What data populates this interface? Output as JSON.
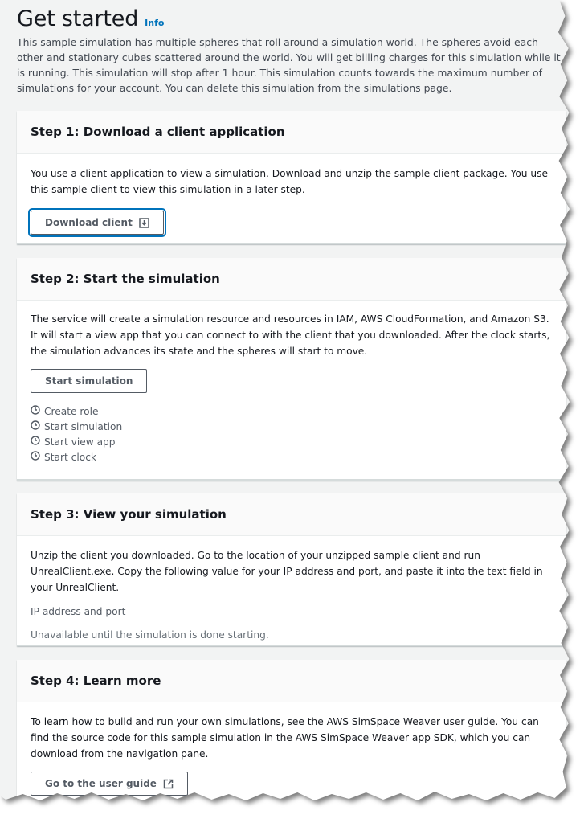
{
  "header": {
    "title": "Get started",
    "info_link": "Info",
    "intro": "This sample simulation has multiple spheres that roll around a simulation world. The spheres avoid each other and stationary cubes scattered around the world. You will get billing charges for this simulation while it is running. This simulation will stop after 1 hour. This simulation counts towards the maximum number of simulations for your account. You can delete this simulation from the simulations page."
  },
  "step1": {
    "title": "Step 1: Download a client application",
    "text": "You use a client application to view a simulation. Download and unzip the sample client package. You use this sample client to view this simulation in a later step.",
    "button": "Download client",
    "button_icon": "download-icon"
  },
  "step2": {
    "title": "Step 2: Start the simulation",
    "text": "The service will create a simulation resource and resources in IAM, AWS CloudFormation, and Amazon S3. It will start a view app that you can connect to with the client that you downloaded. After the clock starts, the simulation advances its state and the spheres will start to move.",
    "button": "Start simulation",
    "status_items": [
      "Create role",
      "Start simulation",
      "Start view app",
      "Start clock"
    ],
    "status_icon": "pending-clock-icon"
  },
  "step3": {
    "title": "Step 3: View your simulation",
    "text": "Unzip the client you downloaded. Go to the location of your unzipped sample client and run UnrealClient.exe. Copy the following value for your IP address and port, and paste it into the text field in your UnrealClient.",
    "field_label": "IP address and port",
    "field_value": "Unavailable until the simulation is done starting."
  },
  "step4": {
    "title": "Step 4: Learn more",
    "text": "To learn how to build and run your own simulations, see the AWS SimSpace Weaver user guide. You can find the source code for this sample simulation in the AWS SimSpace Weaver app SDK, which you can download from the navigation pane.",
    "button": "Go to the user guide",
    "button_icon": "external-link-icon"
  },
  "colors": {
    "background": "#f2f3f3",
    "link": "#0073bb",
    "text": "#16191f",
    "secondary_text": "#545b64"
  }
}
